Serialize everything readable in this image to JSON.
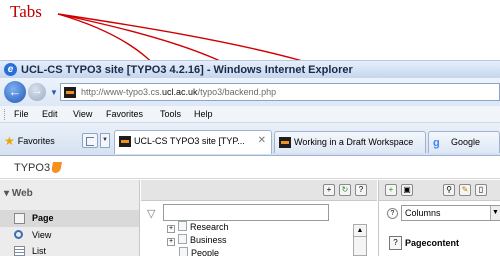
{
  "annotation": {
    "label": "Tabs",
    "color": "#c00000"
  },
  "window": {
    "title": "UCL-CS TYPO3 site [TYPO3 4.2.16] - Windows Internet Explorer",
    "icon": "ie-icon"
  },
  "address_bar": {
    "url_prefix": "http://www-typo3.cs.",
    "url_domain": "ucl.ac.uk",
    "url_suffix": "/typo3/backend.php"
  },
  "menu": {
    "items": [
      "File",
      "Edit",
      "View",
      "Favorites",
      "Tools",
      "Help"
    ]
  },
  "favorites": {
    "label": "Favorites"
  },
  "tabs": [
    {
      "label": "UCL-CS TYPO3 site [TYP...",
      "close": "✕",
      "active": true,
      "icon": "ucl-favicon"
    },
    {
      "label": "Working in a Draft Workspace",
      "active": false,
      "icon": "ucl-favicon"
    },
    {
      "label": "Google",
      "active": false,
      "icon": "google-favicon"
    }
  ],
  "typo3": {
    "logo": "TYPO3"
  },
  "modules": {
    "section": "Web",
    "items": [
      {
        "label": "Page",
        "selected": true
      },
      {
        "label": "View",
        "selected": false
      },
      {
        "label": "List",
        "selected": false
      }
    ]
  },
  "tree": {
    "nodes": [
      "Research",
      "Business",
      "People"
    ]
  },
  "right": {
    "column_select": "Columns",
    "content_title": "Pagecontent"
  }
}
